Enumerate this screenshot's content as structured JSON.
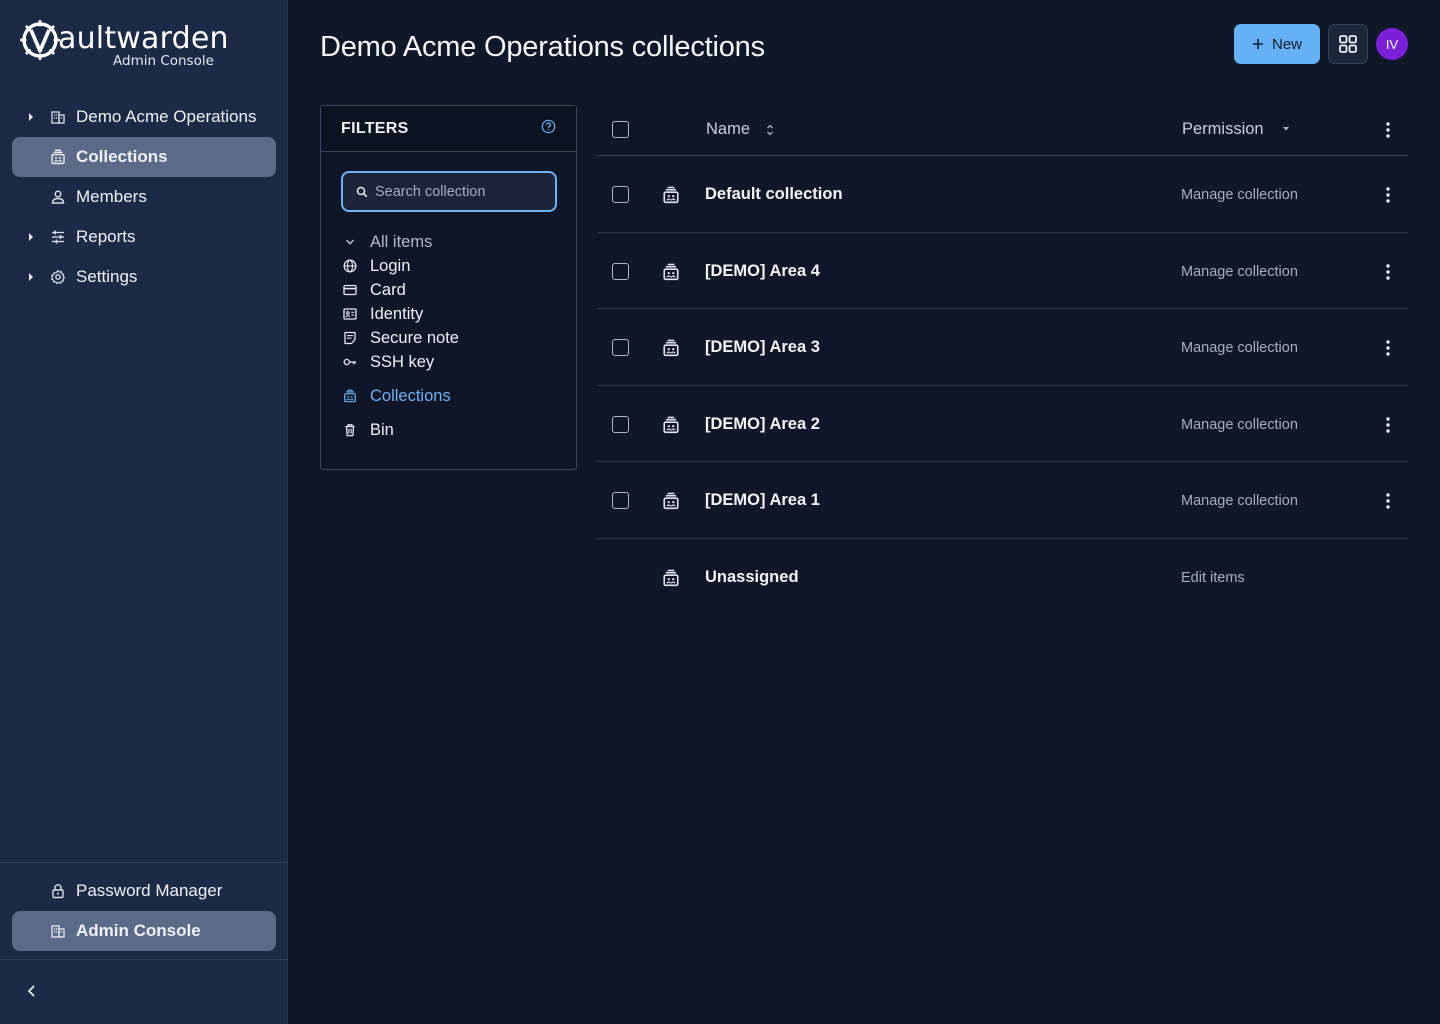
{
  "app": {
    "logo_word": "aultwarden",
    "logo_sub": "Admin Console"
  },
  "sidebar": {
    "items": [
      {
        "label": "Demo Acme Operations",
        "icon": "building-icon",
        "expandable": true
      },
      {
        "label": "Collections",
        "icon": "collection-icon",
        "active": true
      },
      {
        "label": "Members",
        "icon": "user-icon"
      },
      {
        "label": "Reports",
        "icon": "sliders-icon",
        "expandable": true
      },
      {
        "label": "Settings",
        "icon": "gear-icon",
        "expandable": true
      }
    ],
    "bottom_items": [
      {
        "label": "Password Manager",
        "icon": "lock-icon"
      },
      {
        "label": "Admin Console",
        "icon": "building-icon",
        "active": true
      }
    ]
  },
  "header": {
    "title": "Demo Acme Operations collections",
    "new_label": "New",
    "avatar_initials": "IV",
    "accent": "#66b1f5",
    "avatar_color": "#7b1fd8"
  },
  "filters": {
    "title": "FILTERS",
    "search_placeholder": "Search collection",
    "items": [
      {
        "label": "All items",
        "icon": "chevron-down-icon"
      },
      {
        "label": "Login",
        "icon": "globe-icon"
      },
      {
        "label": "Card",
        "icon": "credit-card-icon"
      },
      {
        "label": "Identity",
        "icon": "id-card-icon"
      },
      {
        "label": "Secure note",
        "icon": "note-icon"
      },
      {
        "label": "SSH key",
        "icon": "key-icon"
      }
    ],
    "collections_label": "Collections",
    "bin_label": "Bin"
  },
  "table": {
    "col_name": "Name",
    "col_permission": "Permission",
    "rows": [
      {
        "name": "Default collection",
        "permission": "Manage collection"
      },
      {
        "name": "[DEMO] Area 4",
        "permission": "Manage collection"
      },
      {
        "name": "[DEMO] Area 3",
        "permission": "Manage collection"
      },
      {
        "name": "[DEMO] Area 2",
        "permission": "Manage collection"
      },
      {
        "name": "[DEMO] Area 1",
        "permission": "Manage collection"
      },
      {
        "name": "Unassigned",
        "permission": "Edit items"
      }
    ]
  }
}
